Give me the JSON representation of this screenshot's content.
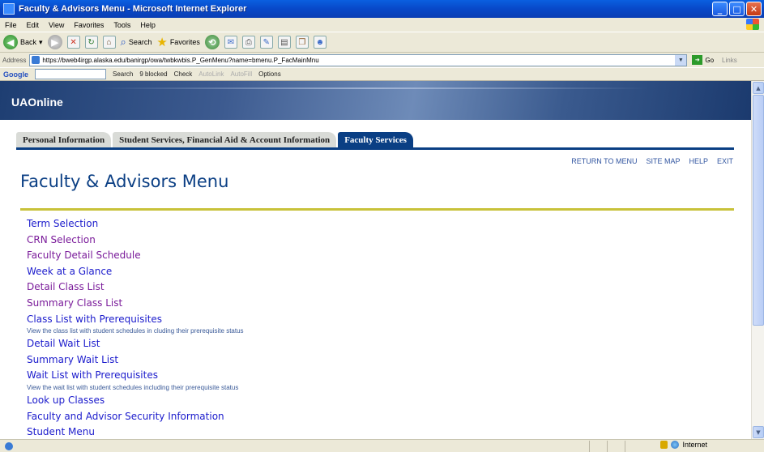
{
  "window": {
    "title": "Faculty & Advisors Menu - Microsoft Internet Explorer"
  },
  "menubar": [
    "File",
    "Edit",
    "View",
    "Favorites",
    "Tools",
    "Help"
  ],
  "toolbar": {
    "back": "Back",
    "search": "Search",
    "favorites": "Favorites"
  },
  "address": {
    "label": "Address",
    "url": "https://bweb4irgp.alaska.edu/banirgp/owa/twbkwbis.P_GenMenu?name=bmenu.P_FacMainMnu",
    "go": "Go",
    "links": "Links"
  },
  "google_toolbar": {
    "logo": "Google",
    "items": [
      "Search",
      "9 blocked",
      "Check",
      "AutoLink",
      "AutoFill",
      "Options"
    ]
  },
  "banner": {
    "brand": "UAOnline"
  },
  "tabs": [
    {
      "label": "Personal Information"
    },
    {
      "label": "Student Services, Financial Aid & Account Information"
    },
    {
      "label": "Faculty Services"
    }
  ],
  "toplinks": [
    "RETURN TO MENU",
    "SITE MAP",
    "HELP",
    "EXIT"
  ],
  "page_title": "Faculty & Advisors Menu",
  "menu": [
    {
      "label": "Term Selection"
    },
    {
      "label": "CRN Selection",
      "visited": true
    },
    {
      "label": "Faculty Detail Schedule",
      "visited": true
    },
    {
      "label": "Week at a Glance"
    },
    {
      "label": "Detail Class List",
      "visited": true
    },
    {
      "label": "Summary Class List",
      "visited": true
    },
    {
      "label": "Class List with Prerequisites",
      "desc": "View the class list with student schedules in cluding their prerequisite status"
    },
    {
      "label": "Detail Wait List"
    },
    {
      "label": "Summary Wait List"
    },
    {
      "label": "Wait List with Prerequisites",
      "desc": "View the wait list with student schedules including their prerequisite status"
    },
    {
      "label": "Look up Classes"
    },
    {
      "label": "Faculty and Advisor Security Information"
    },
    {
      "label": "Student Menu"
    }
  ],
  "status": {
    "zone": "Internet"
  },
  "colors": {
    "link": "#1b1bcc",
    "visited": "#7a1b9a",
    "title": "#0b3f84",
    "rule": "#c8c23a",
    "tab_active": "#0a3f84"
  }
}
